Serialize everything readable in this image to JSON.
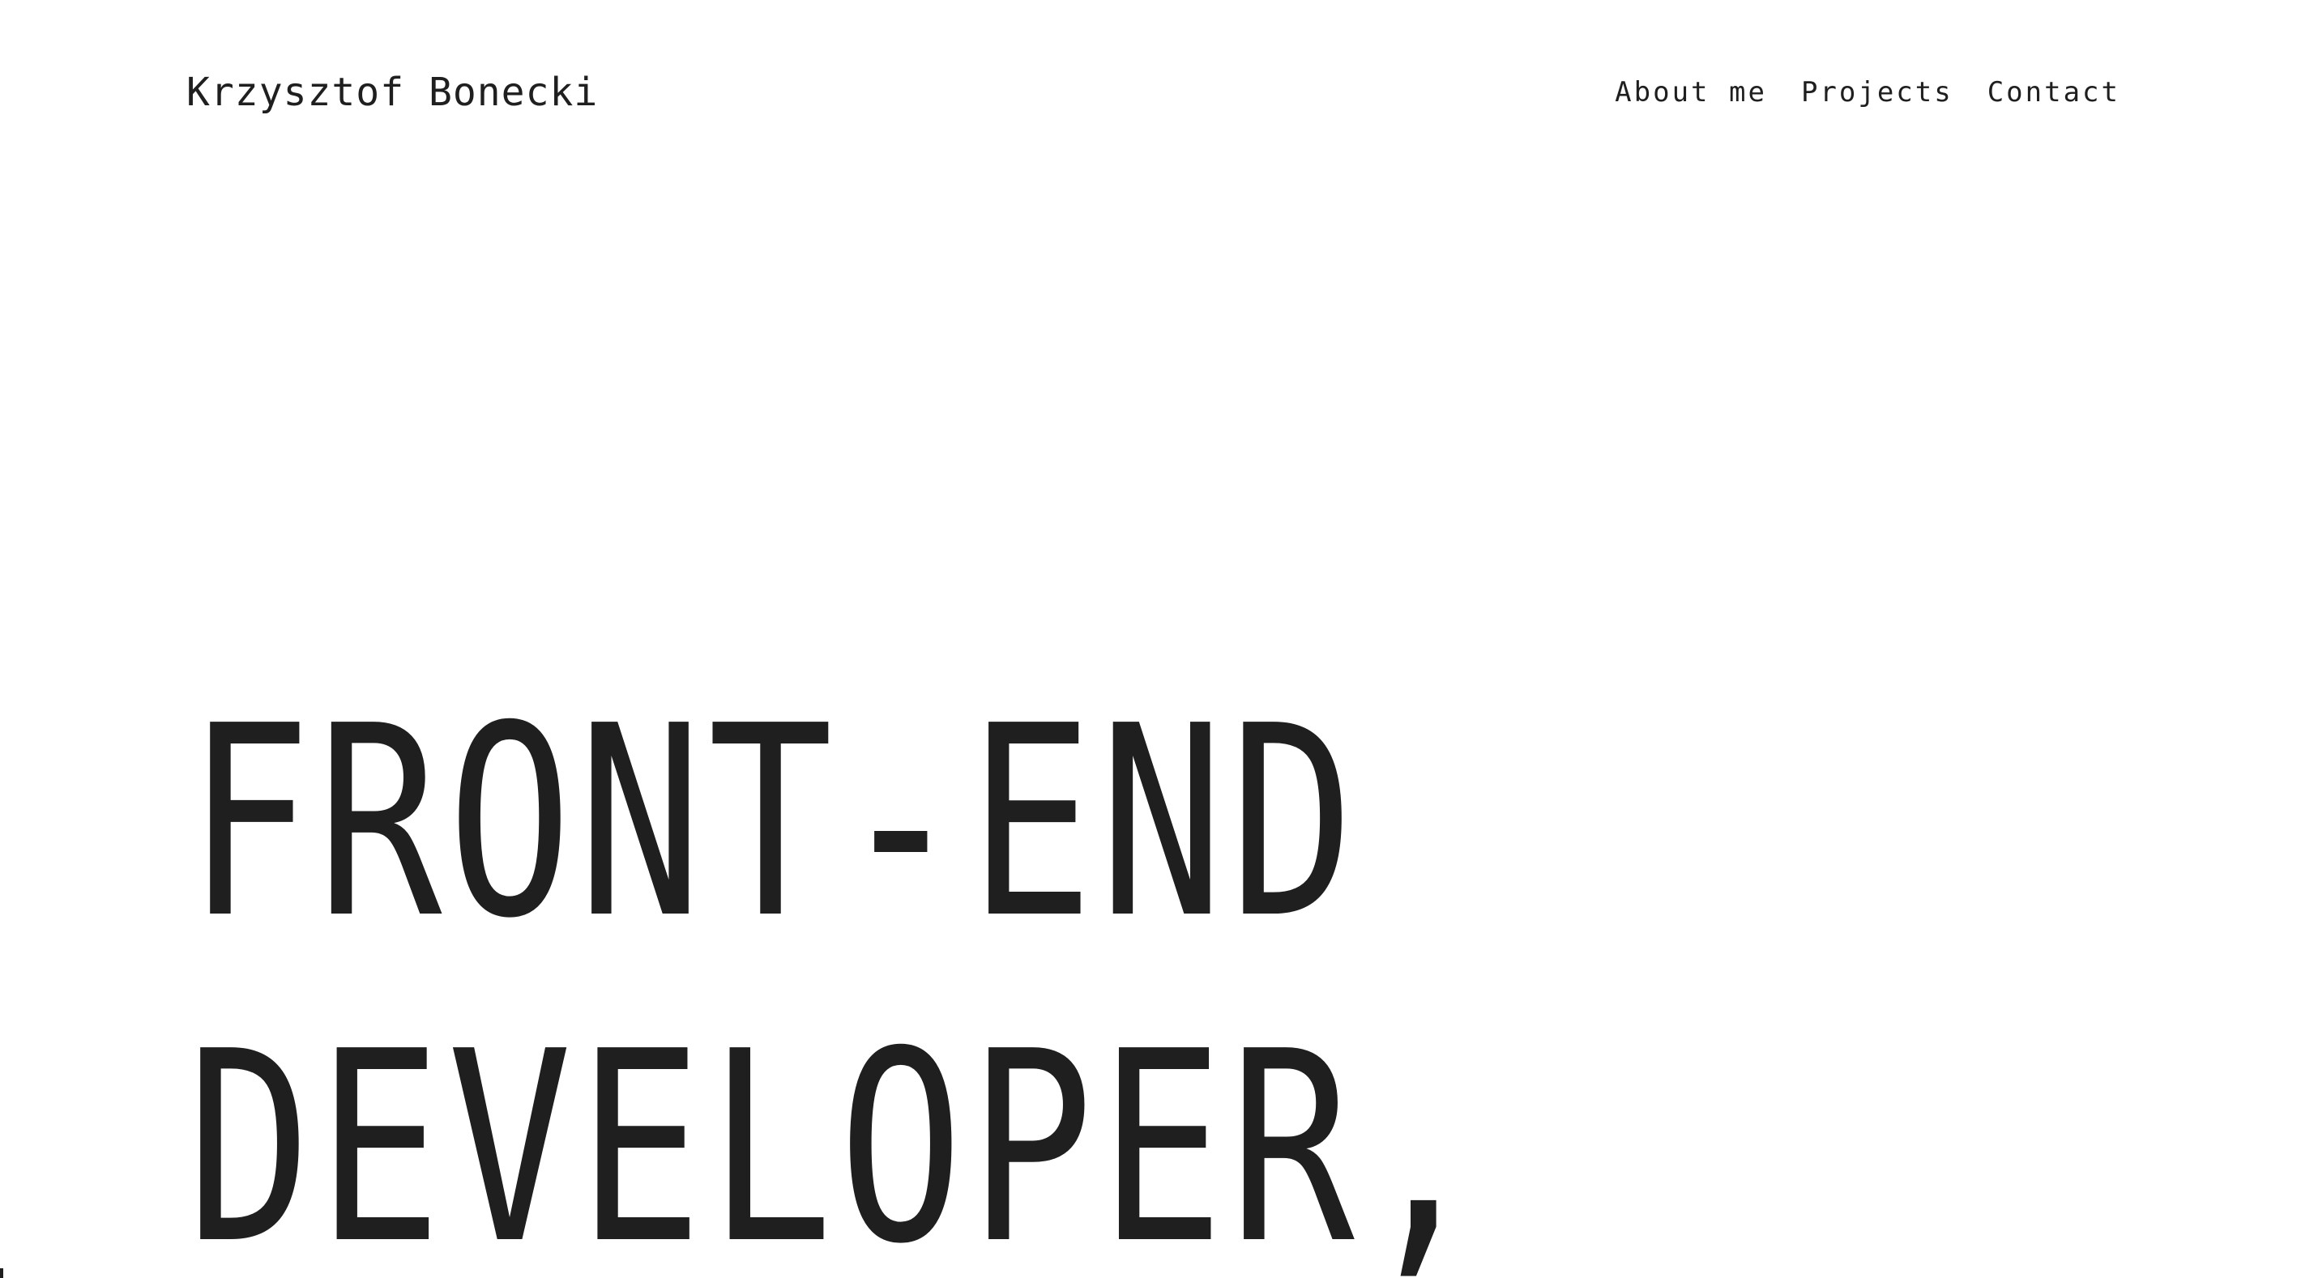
{
  "site": {
    "brand": "Krzysztof Bonecki"
  },
  "nav": {
    "items": [
      "About me",
      "Projects",
      "Contact"
    ]
  },
  "hero": {
    "line1": "FRONT-END",
    "line2": "DEVELOPER,"
  },
  "colors": {
    "background": "#ffffff",
    "text": "#1f1f1f"
  }
}
